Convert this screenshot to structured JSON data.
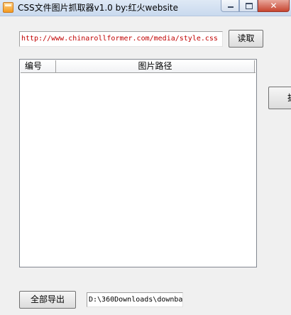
{
  "window": {
    "title": "CSS文件图片抓取器v1.0  by:红火website",
    "close_glyph": "✕"
  },
  "url_field": {
    "value": "http://www.chinarollformer.com/media/style.css"
  },
  "read_button": {
    "label": "读取"
  },
  "list": {
    "columns": [
      "编号",
      "图片路径"
    ],
    "rows": []
  },
  "side_button": {
    "label": "抓"
  },
  "export_button": {
    "label": "全部导出"
  },
  "path_field": {
    "value": "D:\\360Downloads\\downba"
  }
}
